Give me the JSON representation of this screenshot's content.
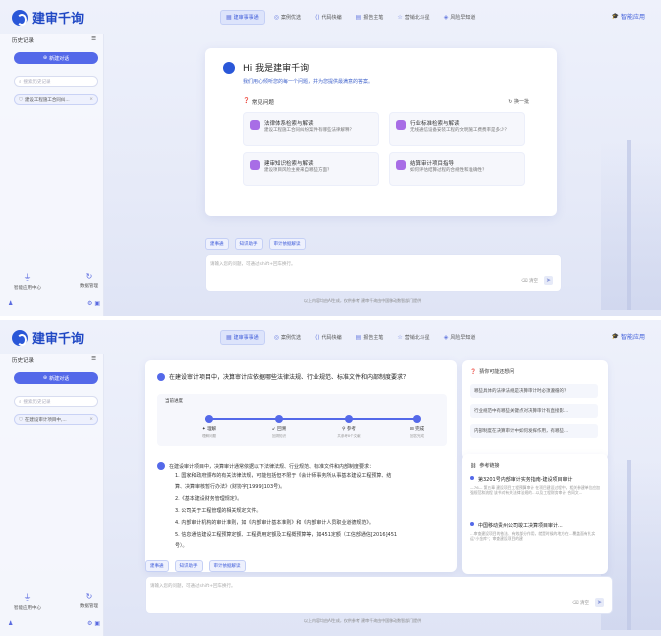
{
  "app": {
    "name": "建审千询",
    "smart_app": "智能应用"
  },
  "nav_tabs": [
    {
      "label": "建审事事通",
      "icon": "grid-icon",
      "active": true
    },
    {
      "label": "案例优选",
      "icon": "compass-icon",
      "active": false
    },
    {
      "label": "代码快编",
      "icon": "code-icon",
      "active": false
    },
    {
      "label": "报告主笔",
      "icon": "document-icon",
      "active": false
    },
    {
      "label": "营销北斗星",
      "icon": "star-icon",
      "active": false
    },
    {
      "label": "风险早知道",
      "icon": "shield-icon",
      "active": false
    }
  ],
  "sidebar": {
    "title": "历史记录",
    "new_chat": "新建对话",
    "search_placeholder": "搜索历史记录",
    "history_s1": "建设工程施工合同纠...",
    "history_s2": "在建设审计项目中,...",
    "bottom": [
      {
        "label": "智能应用中心",
        "icon": "funnel-icon"
      },
      {
        "label": "数据管理",
        "icon": "refresh-icon"
      }
    ]
  },
  "welcome": {
    "title": "Hi 我是建审千询",
    "subtitle": "我们用心倾听您的每一个问题，并为您提供最满意的答案。",
    "faq_title": "常见问题",
    "refresh": "换一批",
    "faqs": [
      {
        "title": "法律体系检索与解读",
        "desc": "建设工程施工合同纠纷案件有哪些法律解释？"
      },
      {
        "title": "行业标准检索与解读",
        "desc": "无线通信设备安装工程的文明施工费费率是多少？"
      },
      {
        "title": "建审知识检索与解读",
        "desc": "建设项目风险主要来自哪些方面？"
      },
      {
        "title": "结算审计项目指导",
        "desc": "如何评估结算过程的合规性和准确性？"
      }
    ]
  },
  "input": {
    "chips": [
      "建事通",
      "知识助手",
      "审计依据解读"
    ],
    "placeholder": "请输入您的问题，可通过shift+回车换行。",
    "clear": "清空",
    "disclaimer": "以上内容均由AI生成，仅供参考    建审千询由中国移动数智部门提供"
  },
  "chat": {
    "question": "在建设审计项目中，决算审计应依据哪些法律法规、行业规范、标准文件和内部制度要求？",
    "progress_title": "当前进度",
    "steps": [
      {
        "label": "理解",
        "sub": "理解问题"
      },
      {
        "label": "回溯",
        "sub": "回溯知识"
      },
      {
        "label": "参考",
        "sub": "共参考8个文献"
      },
      {
        "label": "完成",
        "sub": "回答完成"
      }
    ],
    "answer_intro": "在建设审计项目中，决算审计通常依据以下法律法规、行业规范、标准文件和内部制度要求：",
    "answer_items": [
      "1. 国家和政府颁布的有关法律法规，可能包括但不限于《会计师事务所从事基本建设工程预算、结",
      "算、决算审核暂行办法》(财协字[1999]103号)。",
      "2.《基本建设财务管理规定》。",
      "3. 公司关于工程管理的相关规定文件。",
      "4. 内部审计机构的审计准则，如《内部审计基本准则》和《内部审计人员职业道德规范》。",
      "5. 信息通信建设工程预算定额、工程费用定额及工程概预算等，如451定额（工信部通信[2016]451",
      "号）。"
    ]
  },
  "related": {
    "title": "猜你可能还想问",
    "items": [
      "哪些具体的法律法规是决算审计时必须遵循的？",
      "行业规范中有哪些关键点对决算审计有直接影...",
      "内部制度在决算审计中如何发挥作用，有哪些..."
    ]
  },
  "refs": {
    "title": "参考链接",
    "items": [
      {
        "title": "第3201号内部审计实务指南-建设项目审计",
        "desc": "—76— 第五章 建设项目工程预算审计 在项目建设过程中，相关参建单位应加强规范和流程 该书对有关法律法规的…以及工程财务审计 合同文..."
      },
      {
        "title": "中国移动贵州公司竣工决算项目审计...",
        "desc": "…审查建设项目的依法、有效部分作用，就是时候的地方在…覆盖面有扎实运\"小金库\"；审查建设项目的建"
      }
    ]
  }
}
